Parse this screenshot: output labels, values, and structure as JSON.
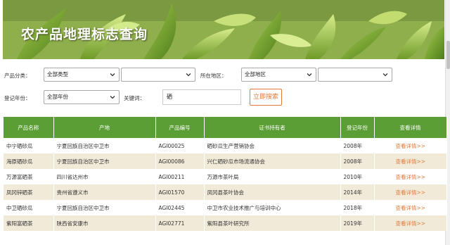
{
  "banner": {
    "title": "农产品地理标志查询"
  },
  "filters": {
    "category_label": "产品分类：",
    "category_value": "全部类型",
    "subcategory_value": "",
    "region_label": "所在地区：",
    "region_value": "全部地区",
    "subregion_value": "",
    "year_label": "登记年份：",
    "year_value": "全部年份",
    "keyword_label": "关键词：",
    "keyword_value": "硒",
    "search_button": "立即搜索"
  },
  "table": {
    "headers": [
      "产品名称",
      "产地",
      "产品编号",
      "证书持有者",
      "登记年份",
      "查看详情"
    ],
    "rows": [
      [
        "中宁硒砂瓜",
        "宁夏回族自治区中卫市",
        "AGI00025",
        "硒砂瓜生产营销协会",
        "2008年",
        "查看详情>>"
      ],
      [
        "海原硒砂瓜",
        "宁夏回族自治区中卫市",
        "AGI00086",
        "兴仁硒砂瓜市场流通协会",
        "2008年",
        "查看详情>>"
      ],
      [
        "万源富硒茶",
        "四川省达州市",
        "AGI00211",
        "万源市茶叶局",
        "2010年",
        "查看详情>>"
      ],
      [
        "凤冈锌硒茶",
        "贵州省遵义市",
        "AGI01570",
        "凤冈县茶叶协会",
        "2014年",
        "查看详情>>"
      ],
      [
        "中卫硒砂瓜",
        "宁夏回族自治区中卫市",
        "AGI02445",
        "中卫市农业技术推广与培训中心",
        "2018年",
        "查看详情>>"
      ],
      [
        "紫阳富硒茶",
        "陕西省安康市",
        "AGI02771",
        "紫阳县茶叶研究所",
        "2019年",
        "查看详情>>"
      ]
    ]
  },
  "colors": {
    "header_green": "#5a9e35",
    "link_orange": "#e07b3a",
    "row_alt": "#f1ead8"
  }
}
